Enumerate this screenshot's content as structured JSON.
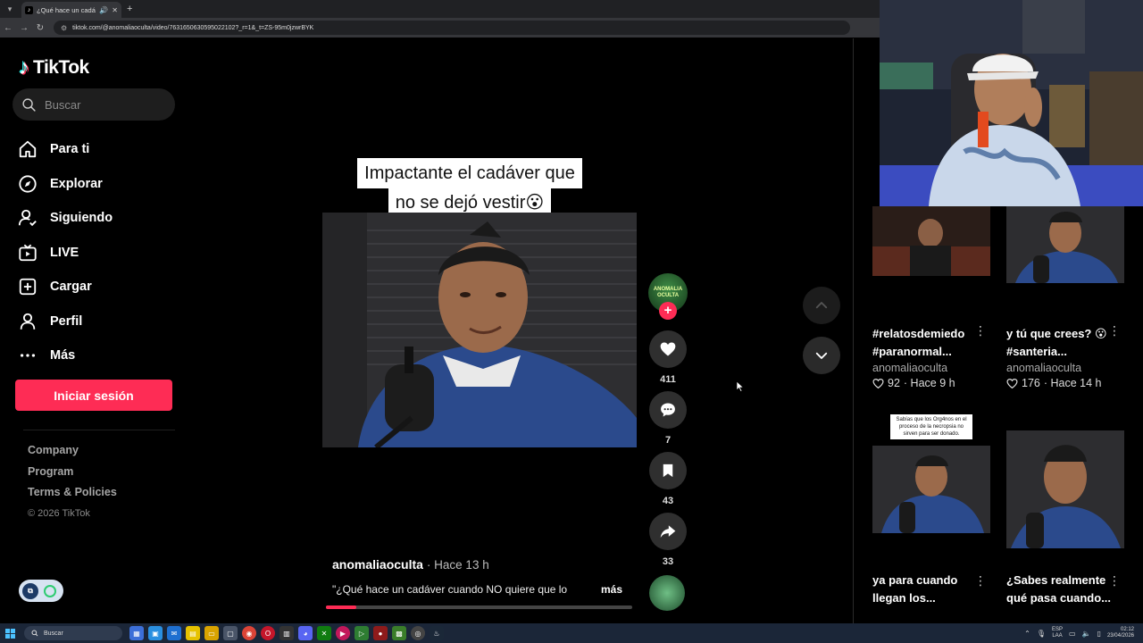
{
  "browser": {
    "tab_title": "¿Qué hace un cadáver cu...",
    "url": "tiktok.com/@anomaliaoculta/video/7631650630595022102?_r=1&_t=ZS-95m0jzwrBYK"
  },
  "sidebar": {
    "logo_text": "TikTok",
    "search_placeholder": "Buscar",
    "nav": [
      {
        "label": "Para ti",
        "icon": "home-icon"
      },
      {
        "label": "Explorar",
        "icon": "compass-icon"
      },
      {
        "label": "Siguiendo",
        "icon": "following-icon"
      },
      {
        "label": "LIVE",
        "icon": "live-icon"
      },
      {
        "label": "Cargar",
        "icon": "upload-icon"
      },
      {
        "label": "Perfil",
        "icon": "profile-icon"
      },
      {
        "label": "Más",
        "icon": "more-icon"
      }
    ],
    "login_button": "Iniciar sesión",
    "footer": {
      "links": [
        "Company",
        "Program",
        "Terms & Policies"
      ],
      "copyright": "© 2026 TikTok"
    }
  },
  "video": {
    "caption_line1": "Impactante el cadáver que",
    "caption_line2": "no se dejó vestir😮",
    "author": "anomaliaoculta",
    "time": "· Hace 13 h",
    "description": "\"¿Qué hace un cadáver cuando NO quiere que lo",
    "more_label": "más",
    "progress": 0.1
  },
  "actions": {
    "avatar_text": "ANOMALIA OCULTA",
    "follow_plus": "+",
    "likes": "411",
    "comments": "7",
    "saves": "43",
    "shares": "33"
  },
  "related": [
    {
      "title": "#relatosdemiedo #paranormal...",
      "author": "anomaliaoculta",
      "likes": "92",
      "time": "· Hace 9 h"
    },
    {
      "title": "y tú que crees? 😮 #santeria...",
      "author": "anomaliaoculta",
      "likes": "176",
      "time": "· Hace 14 h"
    },
    {
      "title": "ya para cuando llegan los...",
      "thumb_text": "Sabías que los Org4nos en el proceso de la necropsia no sirven para ser donado."
    },
    {
      "title": "¿Sabes realmente qué pasa cuando..."
    }
  ],
  "taskbar": {
    "search": "Buscar",
    "lang_line1": "ESP",
    "lang_line2": "LAA",
    "time": "02:12",
    "date": "23/04/2026"
  },
  "colors": {
    "accent": "#fe2c55",
    "background": "#000000"
  }
}
